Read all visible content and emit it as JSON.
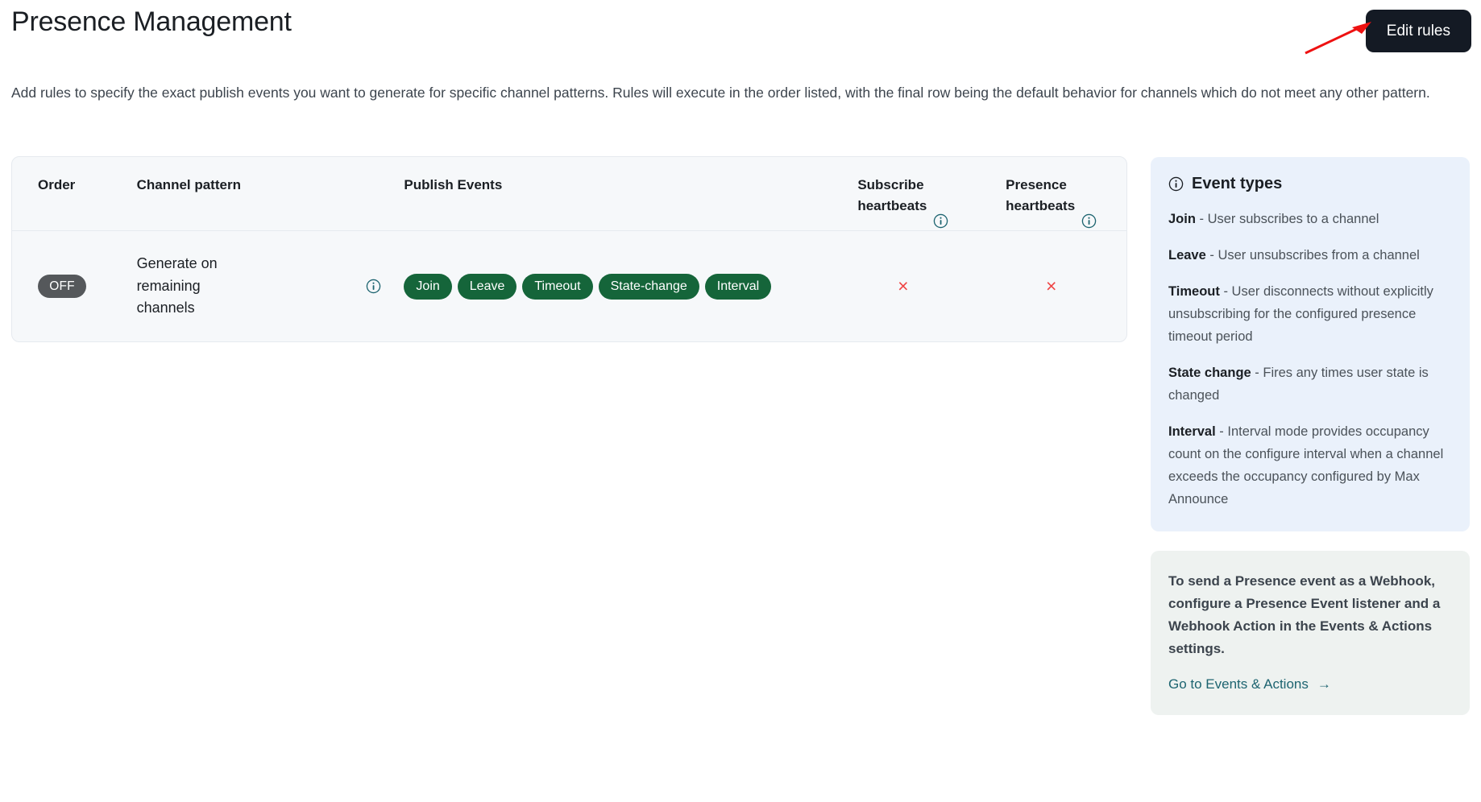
{
  "header": {
    "title": "Presence Management",
    "edit_button_label": "Edit rules"
  },
  "description": "Add rules to specify the exact publish events you want to generate for specific channel patterns. Rules will execute in the order listed, with the final row being the default behavior for channels which do not meet any other pattern.",
  "table": {
    "columns": {
      "order": "Order",
      "channel_pattern": "Channel pattern",
      "publish_events": "Publish Events",
      "subscribe_heartbeats": "Subscribe\nheartbeats",
      "presence_heartbeats": "Presence\nheartbeats"
    },
    "rows": [
      {
        "order_badge": "OFF",
        "channel_pattern": "Generate on remaining channels",
        "publish_events": [
          "Join",
          "Leave",
          "Timeout",
          "State-change",
          "Interval"
        ],
        "subscribe_heartbeats": "×",
        "presence_heartbeats": "×"
      }
    ]
  },
  "event_types_card": {
    "title": "Event types",
    "items": [
      {
        "term": "Join",
        "dash": " - ",
        "definition": "User subscribes to a channel"
      },
      {
        "term": "Leave",
        "dash": " - ",
        "definition": "User unsubscribes from a channel"
      },
      {
        "term": "Timeout",
        "dash": " - ",
        "definition": "User disconnects without explicitly unsubscribing for the configured presence timeout period"
      },
      {
        "term": "State change",
        "dash": " - ",
        "definition": "Fires any times user state is changed"
      },
      {
        "term": "Interval",
        "dash": " - ",
        "definition": "Interval mode provides occupancy count on the configure interval when a channel exceeds the occupancy configured by Max Announce"
      }
    ]
  },
  "webhook_card": {
    "text": "To send a Presence event as a Webhook, configure a Presence Event listener and a Webhook Action in the Events & Actions settings.",
    "link_label": "Go to Events & Actions",
    "link_arrow": "→"
  },
  "colors": {
    "pill_green": "#15653a",
    "badge_grey": "#55585b",
    "x_red": "#ef4444",
    "button_dark": "#141a24",
    "info_teal": "#1d6470",
    "link_teal": "#1d6470",
    "annotation_red": "#ee1111",
    "event_card_bg": "#eaf1fb",
    "webhook_card_bg": "#eef2f0"
  }
}
